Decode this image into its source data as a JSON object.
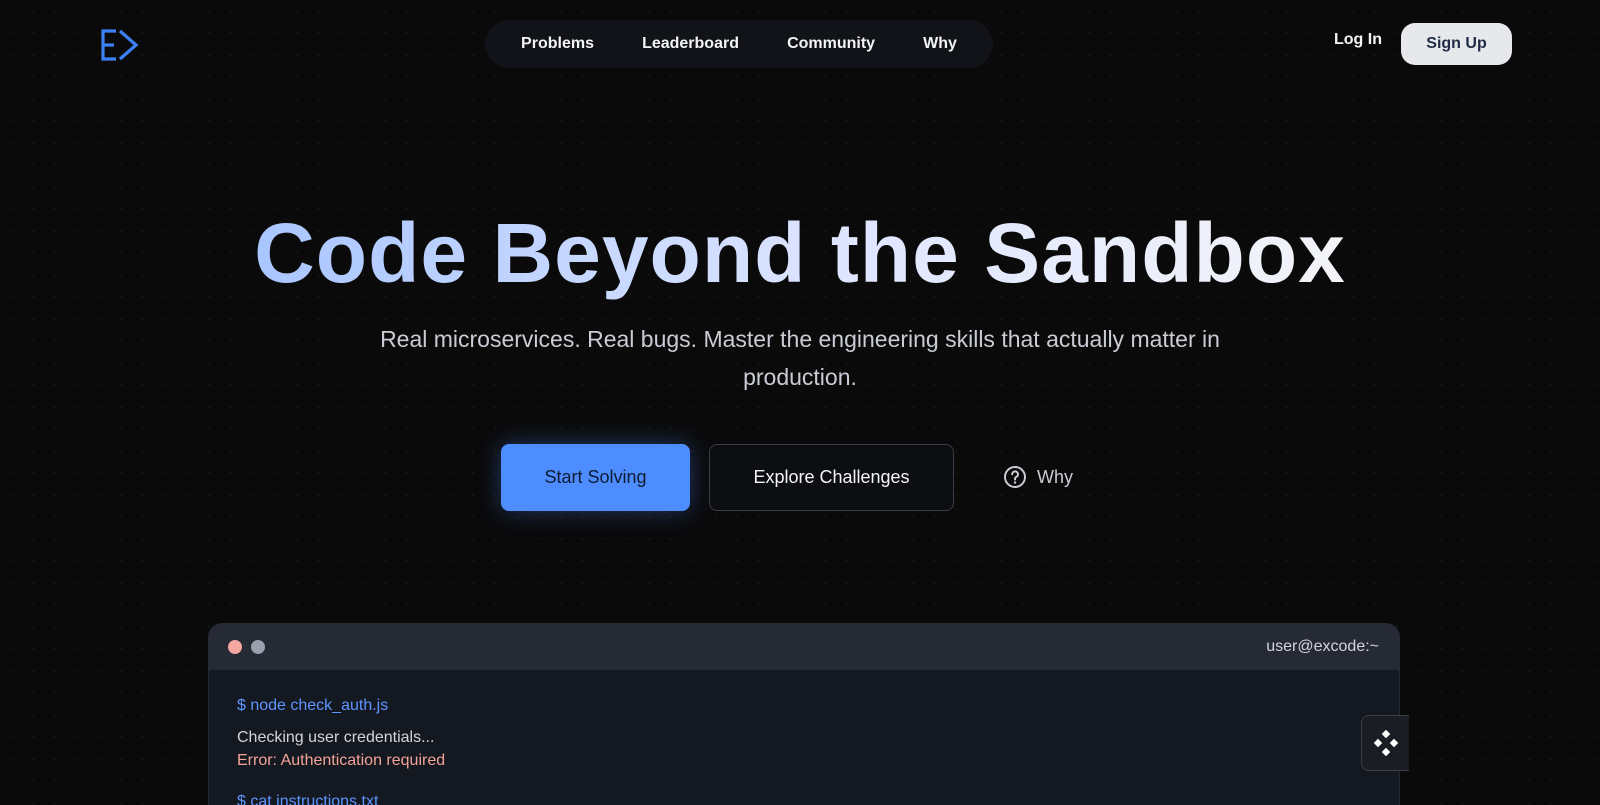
{
  "brand": {
    "logo_icon": "excode-logo-icon",
    "accent": "#3b82f6"
  },
  "nav": {
    "items": [
      {
        "label": "Problems"
      },
      {
        "label": "Leaderboard"
      },
      {
        "label": "Community"
      },
      {
        "label": "Why"
      }
    ]
  },
  "auth": {
    "login_label": "Log In",
    "signup_label": "Sign Up"
  },
  "hero": {
    "title": "Code Beyond the Sandbox",
    "subtitle": "Real microservices. Real bugs. Master the engineering skills that actually matter in production.",
    "primary_cta": "Start Solving",
    "secondary_cta": "Explore Challenges",
    "why_label": "Why",
    "why_icon": "question-circle-icon",
    "primary_color": "#4d8dff"
  },
  "terminal": {
    "title": "user@excode:~",
    "lines": [
      {
        "kind": "command",
        "text": "$ node check_auth.js"
      },
      {
        "kind": "output",
        "text": "Checking user credentials..."
      },
      {
        "kind": "error",
        "text": "Error: Authentication required"
      },
      {
        "kind": "command",
        "text": "$ cat instructions.txt"
      }
    ]
  },
  "floating_widget": {
    "icon": "diamond-grid-icon"
  }
}
